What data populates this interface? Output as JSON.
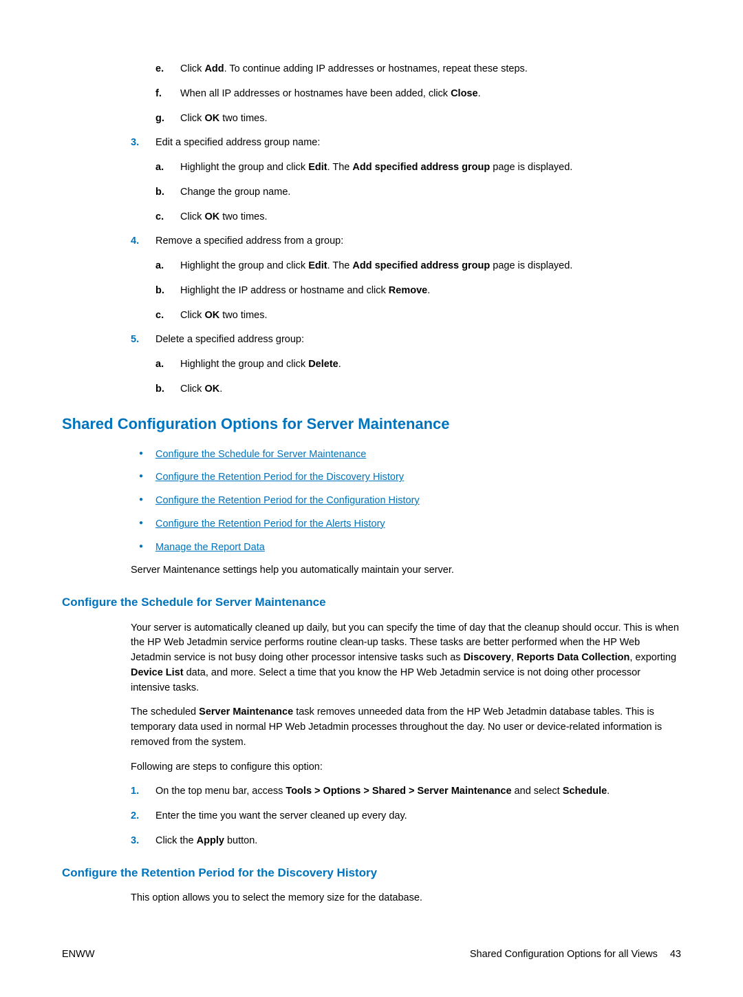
{
  "steps_1_2": {
    "e": {
      "prefix": "Click ",
      "b1": "Add",
      "rest": ". To continue adding IP addresses or hostnames, repeat these steps."
    },
    "f": {
      "prefix": "When all IP addresses or hostnames have been added, click ",
      "b1": "Close",
      "rest": "."
    },
    "g": {
      "prefix": "Click ",
      "b1": "OK",
      "rest": " two times."
    }
  },
  "step3": {
    "intro": "Edit a specified address group name:",
    "a": {
      "prefix": "Highlight the group and click ",
      "b1": "Edit",
      "mid": ". The ",
      "b2": "Add specified address group",
      "rest": " page is displayed."
    },
    "b": {
      "text": "Change the group name."
    },
    "c": {
      "prefix": "Click ",
      "b1": "OK",
      "rest": " two times."
    }
  },
  "step4": {
    "intro": "Remove a specified address from a group:",
    "a": {
      "prefix": "Highlight the group and click ",
      "b1": "Edit",
      "mid": ". The ",
      "b2": "Add specified address group",
      "rest": " page is displayed."
    },
    "b": {
      "prefix": "Highlight the IP address or hostname and click ",
      "b1": "Remove",
      "rest": "."
    },
    "c": {
      "prefix": "Click ",
      "b1": "OK",
      "rest": " two times."
    }
  },
  "step5": {
    "intro": "Delete a specified address group:",
    "a": {
      "prefix": "Highlight the group and click ",
      "b1": "Delete",
      "rest": "."
    },
    "b": {
      "prefix": "Click ",
      "b1": "OK",
      "rest": "."
    }
  },
  "section": {
    "title": "Shared Configuration Options for Server Maintenance",
    "links": [
      "Configure the Schedule for Server Maintenance",
      "Configure the Retention Period for the Discovery History",
      "Configure the Retention Period for the Configuration History",
      "Configure the Retention Period for the Alerts History",
      "Manage the Report Data"
    ],
    "after_links": "Server Maintenance settings help you automatically maintain your server."
  },
  "sub1": {
    "title": "Configure the Schedule for Server Maintenance",
    "p1": {
      "t1": "Your server is automatically cleaned up daily, but you can specify the time of day that the cleanup should occur. This is when the HP Web Jetadmin service performs routine clean-up tasks. These tasks are better performed when the HP Web Jetadmin service is not busy doing other processor intensive tasks such as ",
      "b1": "Discovery",
      "t2": ", ",
      "b2": "Reports Data Collection",
      "t3": ", exporting ",
      "b3": "Device List",
      "t4": " data, and more. Select a time that you know the HP Web Jetadmin service is not doing other processor intensive tasks."
    },
    "p2": {
      "t1": "The scheduled ",
      "b1": "Server Maintenance",
      "t2": " task removes unneeded data from the HP Web Jetadmin database tables. This is temporary data used in normal HP Web Jetadmin processes throughout the day. No user or device-related information is removed from the system."
    },
    "p3": "Following are steps to configure this option:",
    "s1": {
      "t1": "On the top menu bar, access ",
      "b1": "Tools > Options > Shared > Server Maintenance",
      "t2": " and select ",
      "b2": "Schedule",
      "t3": "."
    },
    "s2": "Enter the time you want the server cleaned up every day.",
    "s3": {
      "t1": "Click the ",
      "b1": "Apply",
      "t2": " button."
    }
  },
  "sub2": {
    "title": "Configure the Retention Period for the Discovery History",
    "p1": "This option allows you to select the memory size for the database."
  },
  "footer": {
    "left": "ENWW",
    "right": "Shared Configuration Options for all Views",
    "page": "43"
  },
  "markers": {
    "e": "e.",
    "f": "f.",
    "g": "g.",
    "a": "a.",
    "b": "b.",
    "c": "c.",
    "n1": "1.",
    "n2": "2.",
    "n3": "3.",
    "n4": "4.",
    "n5": "5."
  }
}
